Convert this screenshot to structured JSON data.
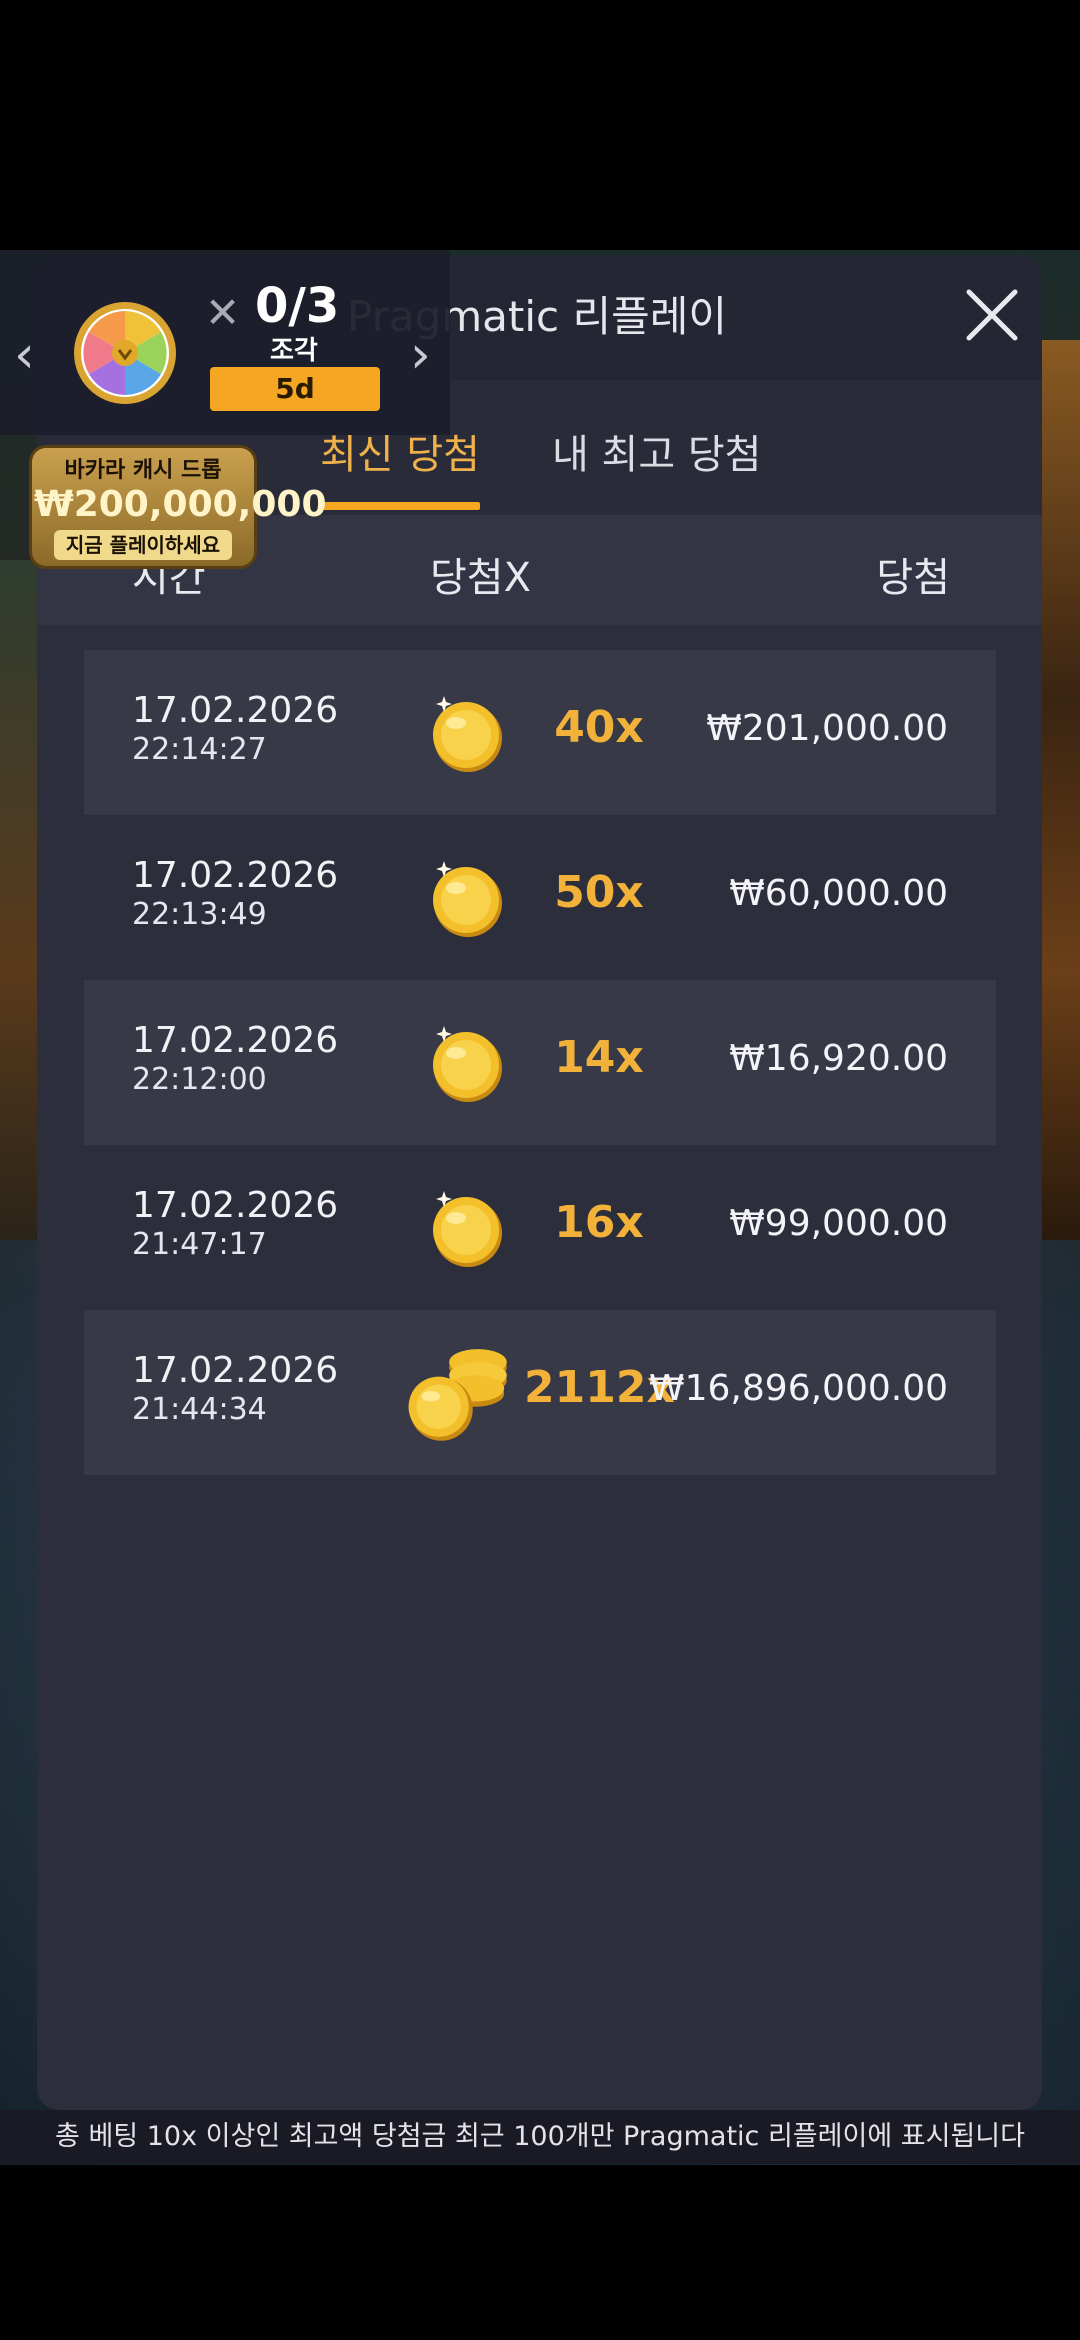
{
  "modal": {
    "title": "Pragmatic 리플레이",
    "tabs": [
      {
        "label": "최신 당첨",
        "active": true
      },
      {
        "label": "내 최고 당첨",
        "active": false
      }
    ],
    "columns": {
      "time": "시간",
      "multiplier": "당첨X",
      "win": "당첨"
    },
    "rows": [
      {
        "date": "17.02.2026",
        "time": "22:14:27",
        "multiplier": "40x",
        "amount": "₩201,000.00",
        "icon": "single-coin-icon"
      },
      {
        "date": "17.02.2026",
        "time": "22:13:49",
        "multiplier": "50x",
        "amount": "₩60,000.00",
        "icon": "single-coin-icon"
      },
      {
        "date": "17.02.2026",
        "time": "22:12:00",
        "multiplier": "14x",
        "amount": "₩16,920.00",
        "icon": "single-coin-icon"
      },
      {
        "date": "17.02.2026",
        "time": "21:47:17",
        "multiplier": "16x",
        "amount": "₩99,000.00",
        "icon": "single-coin-icon"
      },
      {
        "date": "17.02.2026",
        "time": "21:44:34",
        "multiplier": "2112x",
        "amount": "₩16,896,000.00",
        "icon": "coin-stack-icon"
      }
    ],
    "footer_note": "총 베팅 10x 이상인 최고액 당첨금 최근 100개만 Pragmatic 리플레이에 표시됩니다"
  },
  "promo": {
    "count": "0/3",
    "label": "조각",
    "timer": "5d",
    "drop_title": "바카라 캐시 드롭",
    "drop_amount": "₩200,000,000",
    "drop_cta": "지금 플레이하세요"
  },
  "colors": {
    "accent": "#f5a623",
    "multiplier": "#f2b23a",
    "modal_bg": "#2d2e3b",
    "row_shade": "#383947"
  }
}
